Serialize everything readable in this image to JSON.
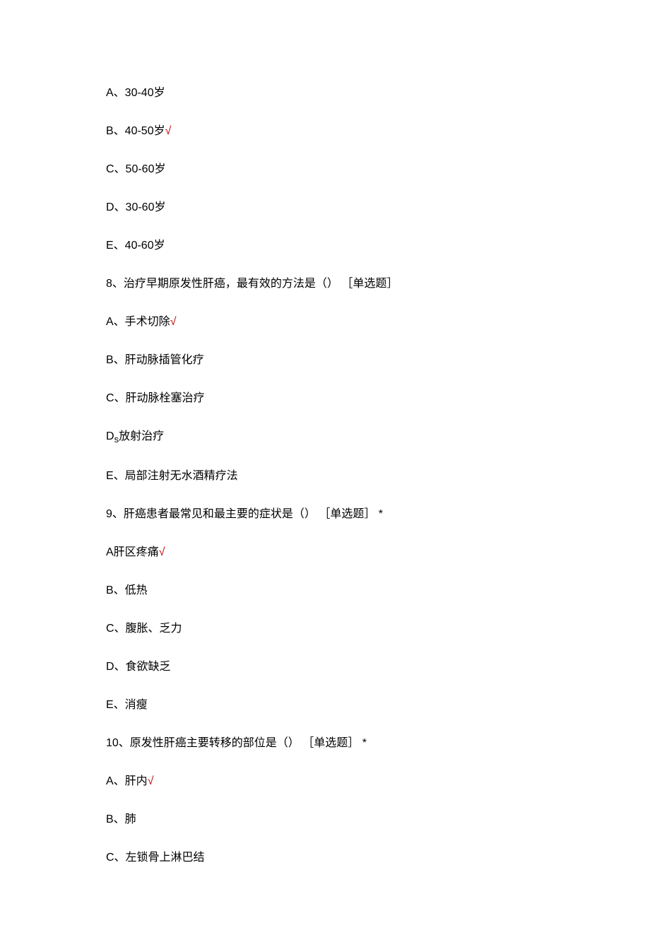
{
  "lines": {
    "l1": "A、30-40岁",
    "l2a": "B、40-50岁",
    "l2b": "√",
    "l3": "C、50-60岁",
    "l4": "D、30-60岁",
    "l5": "E、40-60岁",
    "l6": "8、治疗早期原发性肝癌，最有效的方法是（） ［单选题］",
    "l7a": "A、手术切除",
    "l7b": "√",
    "l8": "B、肝动脉插管化疗",
    "l9": "C、肝动脉栓塞治疗",
    "l10a": "D",
    "l10b": "s",
    "l10c": "放射治疗",
    "l11": "E、局部注射无水酒精疗法",
    "l12": "9、肝癌患者最常见和最主要的症状是（） ［单选题］ *",
    "l13a": "A肝区疼痛",
    "l13b": "√",
    "l14": "B、低热",
    "l15": "C、腹胀、乏力",
    "l16": "D、食欲缺乏",
    "l17": "E、消瘦",
    "l18": "10、原发性肝癌主要转移的部位是（） ［单选题］ *",
    "l19a": "A、肝内",
    "l19b": "√",
    "l20": "B、肺",
    "l21": "C、左锁骨上淋巴结"
  }
}
